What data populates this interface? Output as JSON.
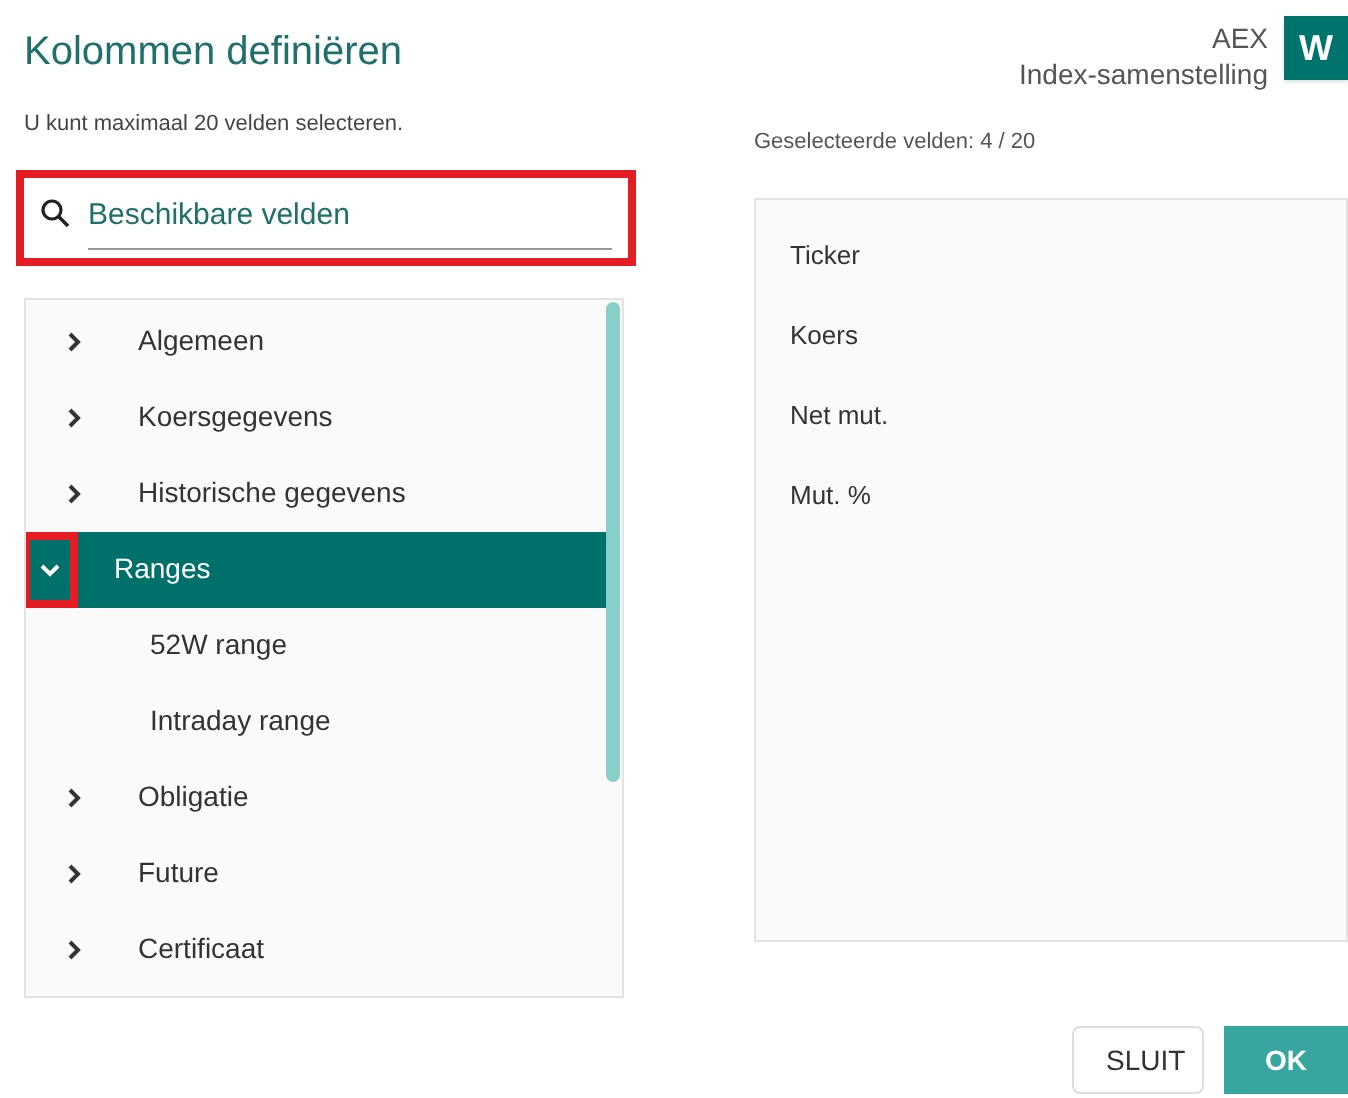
{
  "title": "Kolommen definiëren",
  "context": {
    "line_1": "AEX",
    "line_2": "Index-samenstelling",
    "avatar": "W"
  },
  "hint": "U kunt maximaal 20 velden selecteren.",
  "search": {
    "placeholder": "Beschikbare velden",
    "highlighted": true
  },
  "available": [
    {
      "label": "Algemeen",
      "expanded": false,
      "selected": false,
      "highlighted": false
    },
    {
      "label": "Koersgegevens",
      "expanded": false,
      "selected": false,
      "highlighted": false
    },
    {
      "label": "Historische gegevens",
      "expanded": false,
      "selected": false,
      "highlighted": false
    },
    {
      "label": "Ranges",
      "expanded": true,
      "selected": true,
      "highlighted": true,
      "children": [
        {
          "label": "52W range"
        },
        {
          "label": "Intraday range"
        }
      ]
    },
    {
      "label": "Obligatie",
      "expanded": false,
      "selected": false,
      "highlighted": false
    },
    {
      "label": "Future",
      "expanded": false,
      "selected": false,
      "highlighted": false
    },
    {
      "label": "Certificaat",
      "expanded": false,
      "selected": false,
      "highlighted": false
    }
  ],
  "selected_count": "Geselecteerde velden: 4 / 20",
  "selected_fields": [
    "Ticker",
    "Koers",
    "Net mut.",
    "Mut. %"
  ],
  "buttons": [
    {
      "label": "SLUIT",
      "kind": "secondary"
    },
    {
      "label": "OK",
      "kind": "primary"
    }
  ]
}
